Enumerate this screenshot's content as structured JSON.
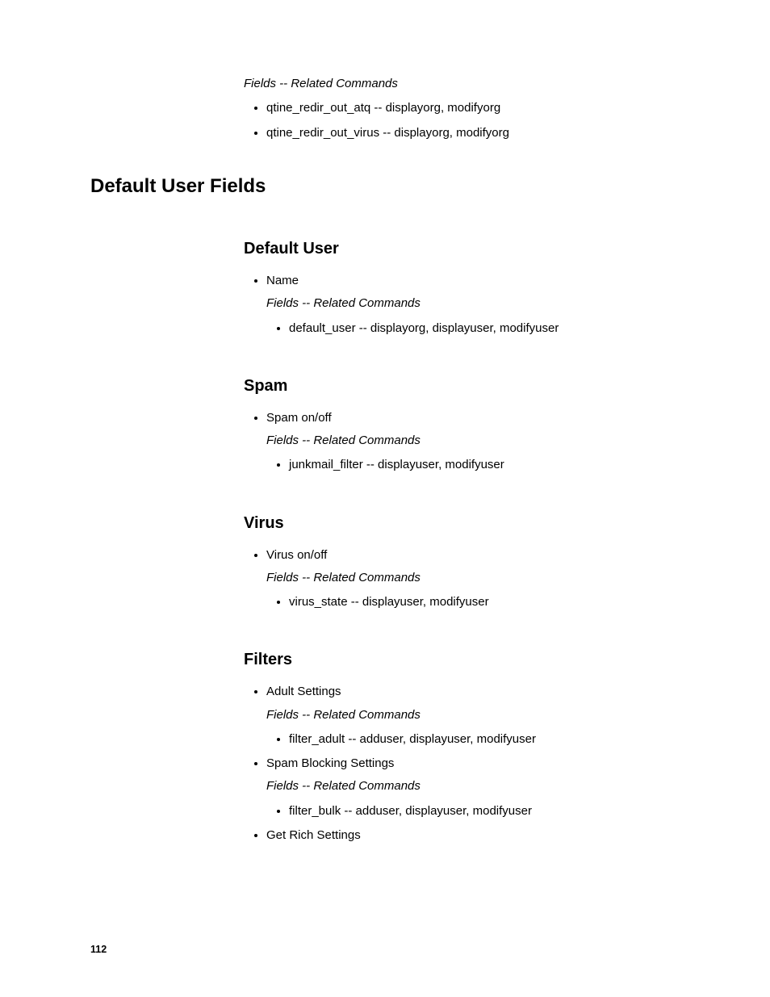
{
  "top": {
    "caption": "Fields -- Related Commands",
    "items": [
      "qtine_redir_out_atq -- displayorg, modifyorg",
      "qtine_redir_out_virus -- displayorg, modifyorg"
    ]
  },
  "sectionTitle": "Default User Fields",
  "sections": [
    {
      "heading": "Default User",
      "groups": [
        {
          "label": "Name",
          "caption": "Fields -- Related Commands",
          "items": [
            "default_user -- displayorg, displayuser, modifyuser"
          ]
        }
      ]
    },
    {
      "heading": "Spam",
      "groups": [
        {
          "label": "Spam on/off",
          "caption": "Fields -- Related Commands",
          "items": [
            "junkmail_filter -- displayuser, modifyuser"
          ]
        }
      ]
    },
    {
      "heading": "Virus",
      "groups": [
        {
          "label": "Virus on/off",
          "caption": "Fields -- Related Commands",
          "items": [
            "virus_state -- displayuser, modifyuser"
          ]
        }
      ]
    },
    {
      "heading": "Filters",
      "groups": [
        {
          "label": "Adult Settings",
          "caption": "Fields -- Related Commands",
          "items": [
            "filter_adult -- adduser, displayuser, modifyuser"
          ]
        },
        {
          "label": "Spam Blocking Settings",
          "caption": "Fields -- Related Commands",
          "items": [
            "filter_bulk -- adduser, displayuser, modifyuser"
          ]
        },
        {
          "label": "Get Rich Settings"
        }
      ]
    }
  ],
  "pageNumber": "112"
}
